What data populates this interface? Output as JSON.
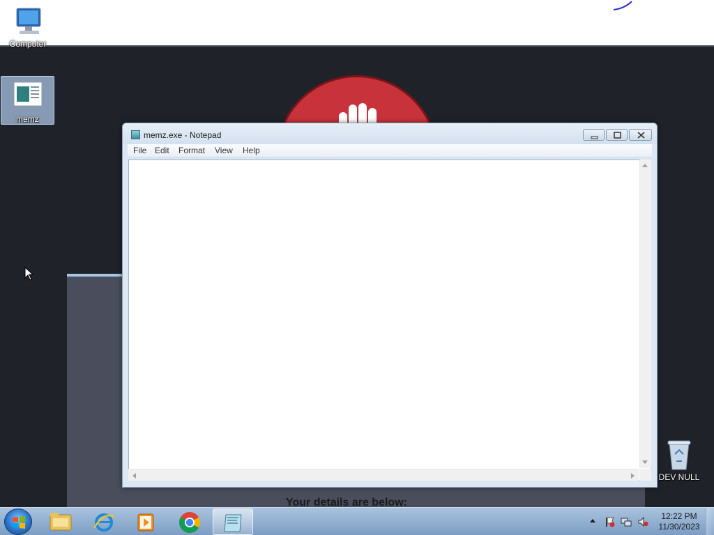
{
  "desktop": {
    "icons": [
      {
        "label": "Computer",
        "icon": "computer-icon"
      },
      {
        "label": "memz",
        "icon": "notepad-file-icon"
      },
      {
        "label": "DEV NULL",
        "icon": "recycle-bin-icon"
      }
    ]
  },
  "background_app": {
    "heading": "Your details are below:"
  },
  "notepad": {
    "title": "memz.exe - Notepad",
    "menu": [
      "File",
      "Edit",
      "Format",
      "View",
      "Help"
    ],
    "content": ""
  },
  "taskbar": {
    "pinned": [
      {
        "name": "windows-explorer",
        "icon": "folder-icon"
      },
      {
        "name": "internet-explorer",
        "icon": "ie-icon"
      },
      {
        "name": "media-player",
        "icon": "media-player-icon"
      },
      {
        "name": "chrome",
        "icon": "chrome-icon"
      },
      {
        "name": "notepad",
        "icon": "notepad-icon",
        "active": true
      }
    ],
    "clock": {
      "time": "12:22 PM",
      "date": "11/30/2023"
    }
  },
  "colors": {
    "desktop_bg": "#20222a",
    "stop_red": "#c8333b",
    "taskbar": "#8fb0d6"
  }
}
